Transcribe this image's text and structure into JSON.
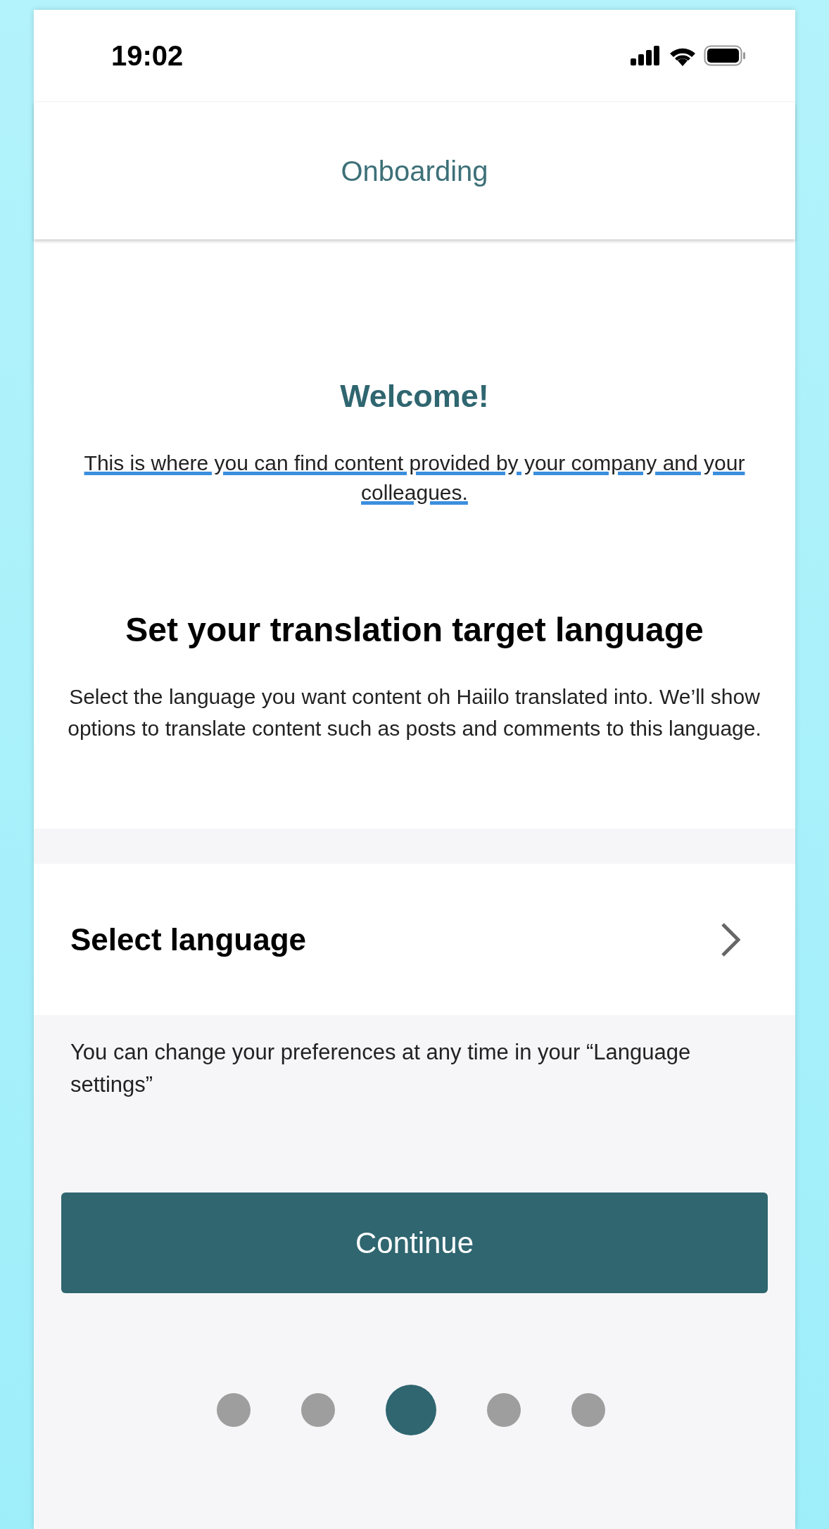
{
  "status_bar": {
    "time": "19:02"
  },
  "header": {
    "title": "Onboarding"
  },
  "welcome": {
    "title": "Welcome!",
    "text": "This is where you can find content provided by your company and your colleagues."
  },
  "translation": {
    "heading": "Set your translation target language",
    "description": "Select the language you want content oh Haiilo translated into. We’ll show options to translate content such as posts and comments to this language."
  },
  "language_row": {
    "label": "Select language"
  },
  "note": "You can change your preferences at any time in your “Language settings”",
  "continue_button": "Continue",
  "pager": [
    {
      "selected": false
    },
    {
      "selected": false
    },
    {
      "selected": true
    },
    {
      "selected": false
    },
    {
      "selected": false
    }
  ]
}
